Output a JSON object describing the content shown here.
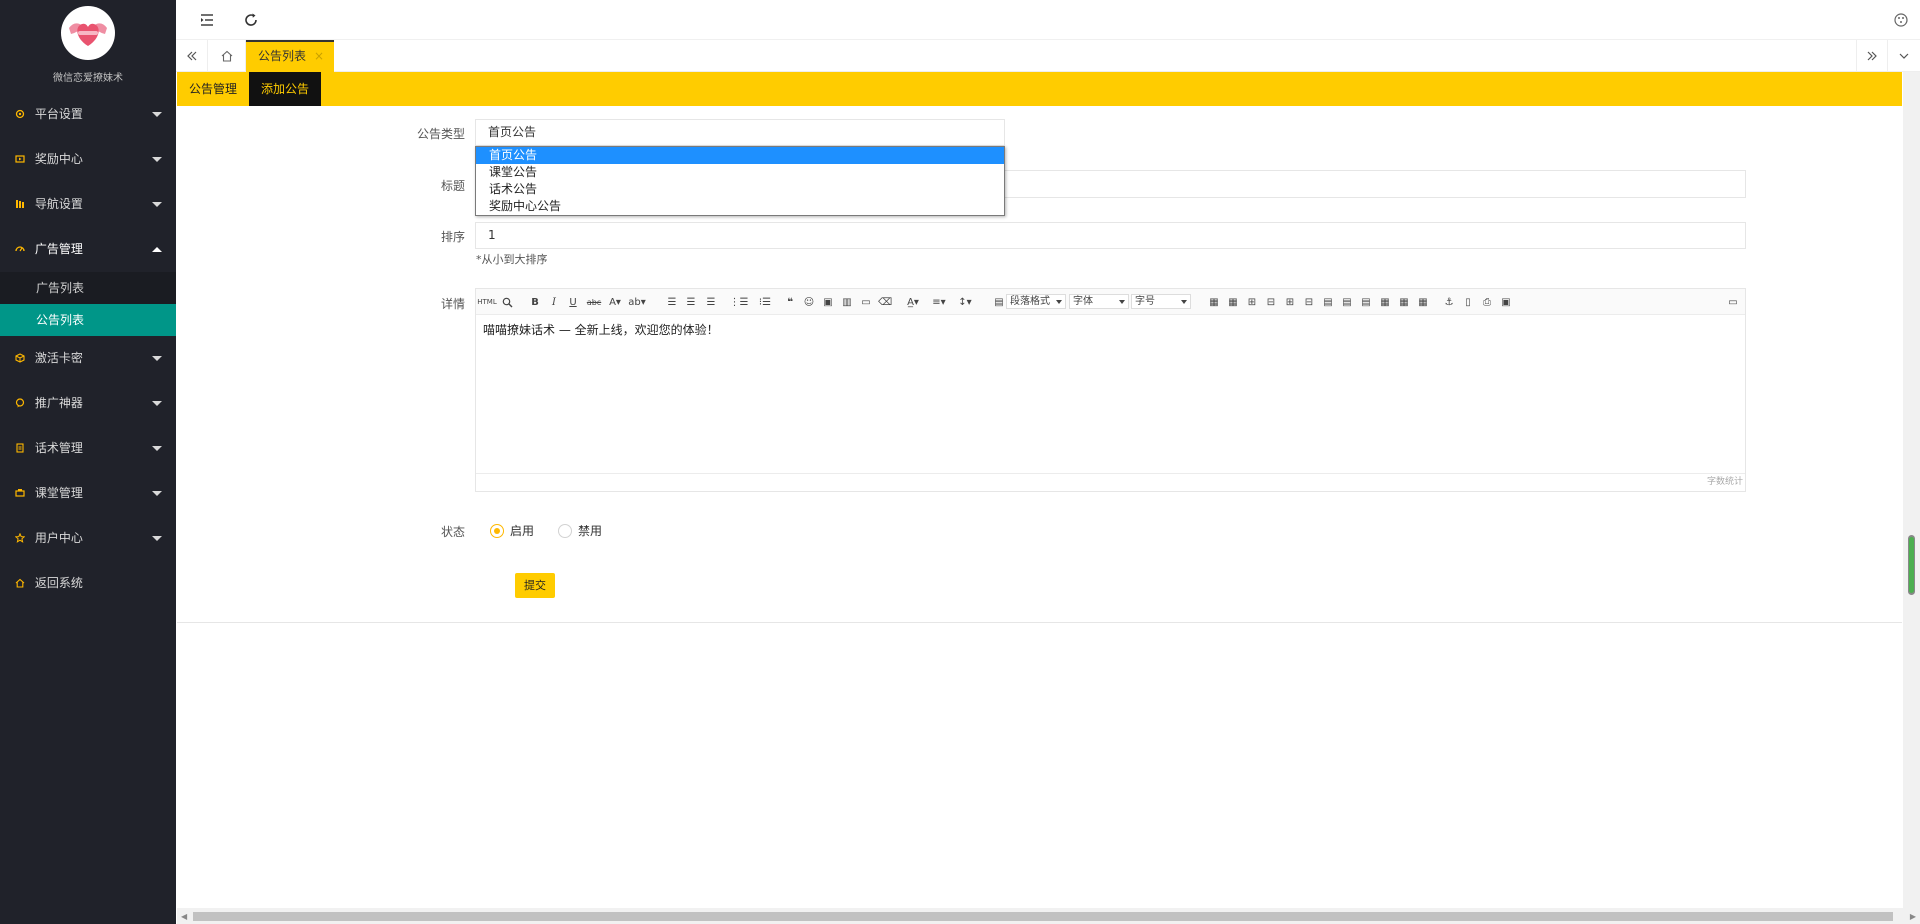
{
  "sidebar": {
    "brand_name": "微信恋爱撩妹术",
    "menu": [
      {
        "label": "平台设置",
        "icon": "gear-icon"
      },
      {
        "label": "奖励中心",
        "icon": "video-icon"
      },
      {
        "label": "导航设置",
        "icon": "nav-icon"
      },
      {
        "label": "广告管理",
        "icon": "dashboard-icon"
      },
      {
        "label": "激活卡密",
        "icon": "cube-icon"
      },
      {
        "label": "推广神器",
        "icon": "chat-icon"
      },
      {
        "label": "话术管理",
        "icon": "doc-icon"
      },
      {
        "label": "课堂管理",
        "icon": "class-icon"
      },
      {
        "label": "用户中心",
        "icon": "star-icon"
      },
      {
        "label": "返回系统",
        "icon": "home-icon"
      }
    ],
    "submenu": [
      {
        "label": "广告列表"
      },
      {
        "label": "公告列表"
      }
    ],
    "accent_color": "#009688"
  },
  "tabs": {
    "active_tab": "公告列表",
    "close_symbol": "×"
  },
  "subnav": {
    "items": [
      "公告管理",
      "添加公告"
    ],
    "active": "添加公告",
    "color": "#FFCC00"
  },
  "form": {
    "type_label": "公告类型",
    "type_value": "首页公告",
    "type_options": [
      "首页公告",
      "课堂公告",
      "话术公告",
      "奖励中心公告"
    ],
    "title_label": "标题",
    "sort_label": "排序",
    "sort_value": "1",
    "sort_hint": "*从小到大排序",
    "detail_label": "详情",
    "detail_content": "喵喵撩妹话术 — 全新上线，欢迎您的体验！",
    "word_count_label": "字数统计",
    "toolbar_selects": [
      "段落格式",
      "字体",
      "字号"
    ],
    "status_label": "状态",
    "status_options": [
      "启用",
      "禁用"
    ],
    "status_selected": "启用",
    "submit_label": "提交"
  }
}
